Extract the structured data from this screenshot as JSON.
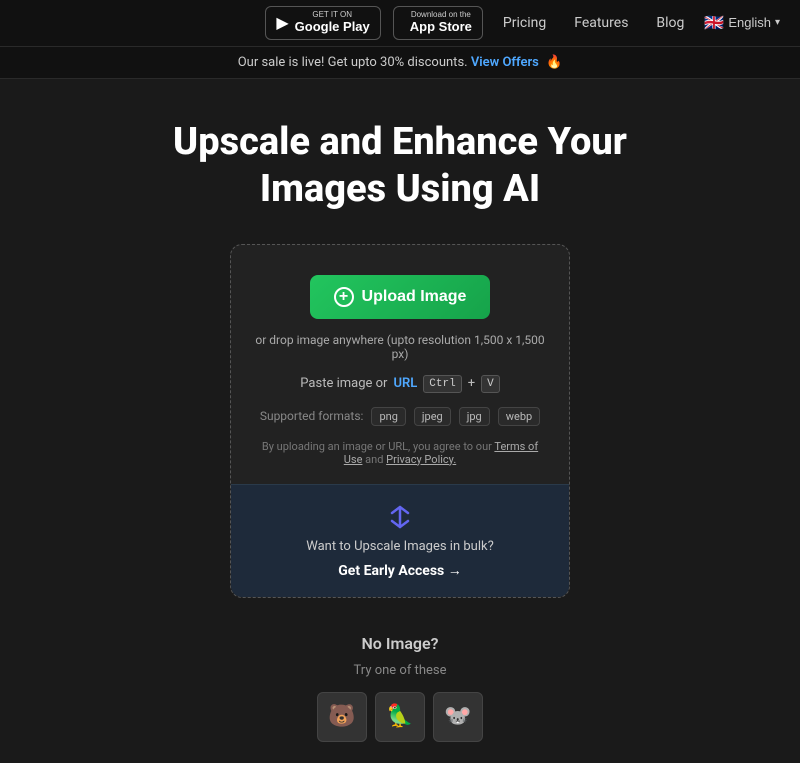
{
  "navbar": {
    "google_play": {
      "top_label": "GET IT ON",
      "bottom_label": "Google Play"
    },
    "app_store": {
      "top_label": "Download on the",
      "bottom_label": "App Store"
    },
    "links": [
      {
        "id": "pricing",
        "label": "Pricing"
      },
      {
        "id": "features",
        "label": "Features"
      },
      {
        "id": "blog",
        "label": "Blog"
      }
    ],
    "lang": {
      "flag": "🇬🇧",
      "label": "English"
    }
  },
  "sale_banner": {
    "text": "Our sale is live! Get upto 30% discounts.",
    "link_label": "View Offers",
    "emoji": "🔥"
  },
  "main": {
    "title_line1": "Upscale and Enhance Your",
    "title_line2": "Images Using AI"
  },
  "upload_area": {
    "upload_btn_label": "Upload Image",
    "drop_hint": "or drop image anywhere (upto resolution 1,500 x 1,500 px)",
    "paste_label": "Paste image or",
    "url_label": "URL",
    "ctrl_key": "Ctrl",
    "v_key": "V",
    "formats_label": "Supported formats:",
    "formats": [
      "png",
      "jpeg",
      "jpg",
      "webp"
    ],
    "terms_prefix": "By uploading an image or URL, you agree to our",
    "terms_link": "Terms of Use",
    "and_text": "and",
    "privacy_link": "Privacy Policy."
  },
  "bulk_section": {
    "text": "Want to Upscale Images in bulk?",
    "link_label": "Get Early Access →"
  },
  "no_image": {
    "title": "No Image?",
    "subtitle": "Try one of these",
    "samples": [
      "🐻",
      "🦜",
      "🐭"
    ]
  },
  "colors": {
    "accent": "#4fa8ff",
    "green_btn": "#22c55e",
    "bulk_bg": "#1e2a3a",
    "purple": "#6366f1"
  }
}
